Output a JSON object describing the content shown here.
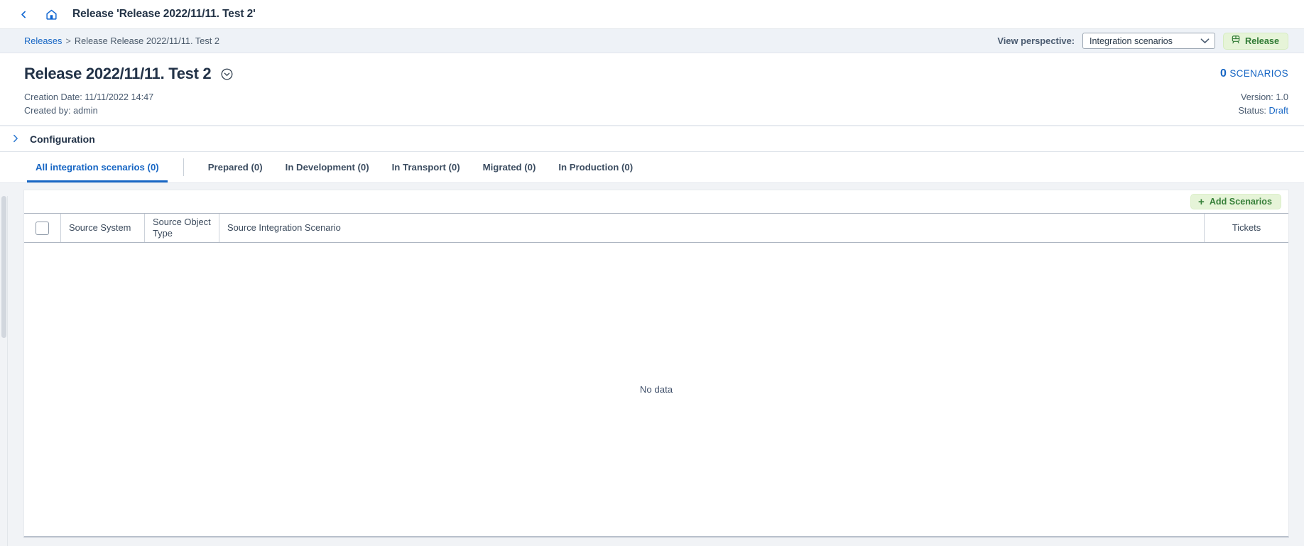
{
  "appbar": {
    "back_icon": "chevron-left-icon",
    "home_icon": "home-icon",
    "title": "Release 'Release 2022/11/11. Test 2'"
  },
  "breadcrumb": {
    "root": "Releases",
    "separator": ">",
    "current": "Release Release 2022/11/11. Test 2"
  },
  "toolbar": {
    "view_perspective_label": "View perspective:",
    "view_perspective_value": "Integration scenarios",
    "view_perspective_options": [
      "Integration scenarios"
    ],
    "release_button_label": "Release",
    "release_button_icon": "train-icon",
    "chevron_icon": "chevron-down-icon"
  },
  "header": {
    "title": "Release 2022/11/11. Test 2",
    "title_chevron_icon": "chevron-down-circle-icon",
    "scenario_count": "0",
    "scenario_count_label": "SCENARIOS",
    "creation_date": "Creation Date: 11/11/2022 14:47",
    "created_by": "Created by: admin",
    "version": "Version: 1.0",
    "status_label": "Status:",
    "status_value": "Draft"
  },
  "configuration": {
    "label": "Configuration",
    "chevron_icon": "chevron-right-icon",
    "expanded": false
  },
  "tabs": [
    {
      "label": "All integration scenarios (0)",
      "active": true
    },
    {
      "label": "Prepared (0)",
      "active": false
    },
    {
      "label": "In Development (0)",
      "active": false
    },
    {
      "label": "In Transport (0)",
      "active": false
    },
    {
      "label": "Migrated (0)",
      "active": false
    },
    {
      "label": "In Production (0)",
      "active": false
    }
  ],
  "table": {
    "add_button_label": "Add Scenarios",
    "add_button_icon": "plus-icon",
    "columns": {
      "select_all": "",
      "source_system": "Source System",
      "source_object_type": "Source Object Type",
      "source_integration_scenario": "Source Integration Scenario",
      "tickets": "Tickets"
    },
    "rows": [],
    "empty_message": "No data"
  },
  "colors": {
    "accent_blue": "#1766c4",
    "green_button_bg": "#e6f4d8",
    "green_button_text": "#2f7a34",
    "page_bg": "#f1f3f6",
    "text_dark": "#233348"
  }
}
